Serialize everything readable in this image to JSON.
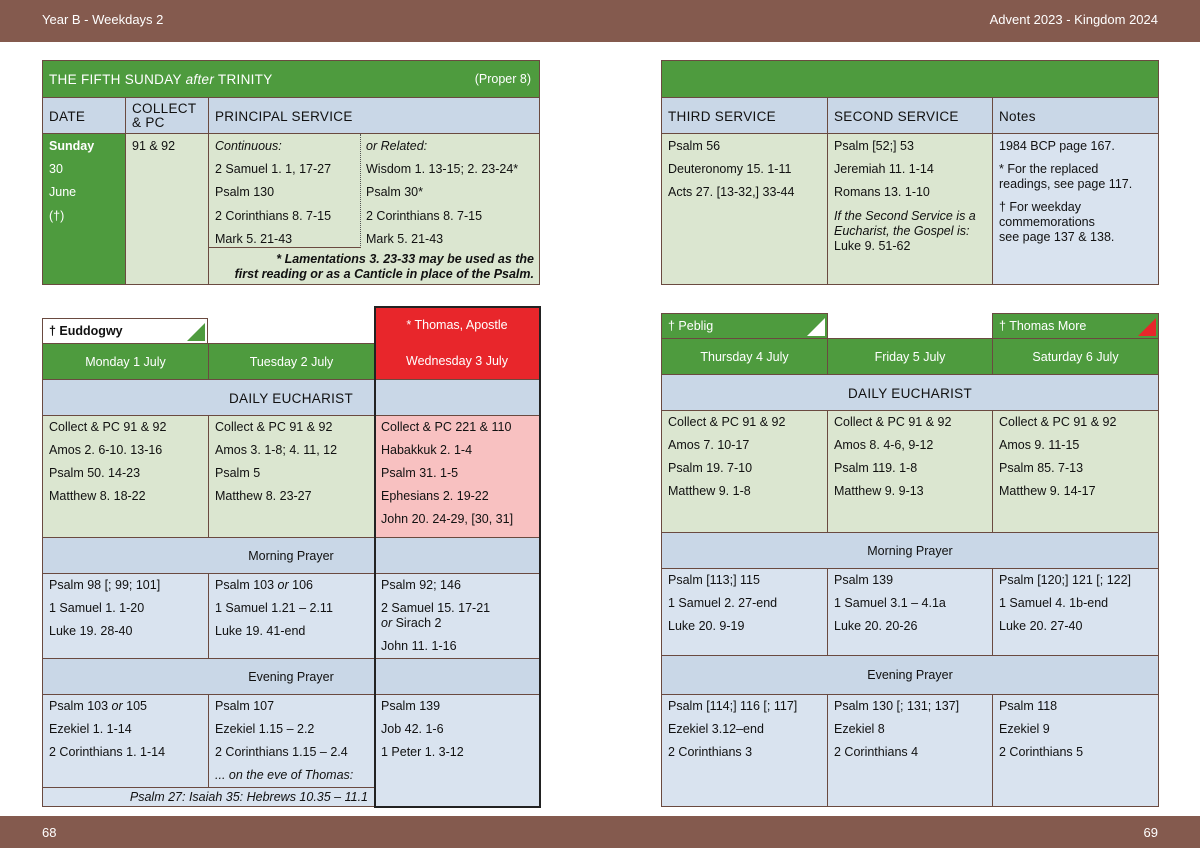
{
  "header": {
    "left": "Year B - Weekdays 2",
    "right": "Advent  2023 - Kingdom 2024"
  },
  "footer": {
    "left": "68",
    "right": "69"
  },
  "sunday": {
    "title_a": "THE FIFTH SUNDAY ",
    "title_b": "after",
    "title_c": " TRINITY",
    "proper": "(Proper 8)",
    "col_date": "DATE",
    "col_collect_1": "COLLECT",
    "col_collect_2": "& PC",
    "col_principal": "PRINCIPAL SERVICE",
    "date": [
      "Sunday",
      "30",
      "June",
      "(†)"
    ],
    "collect": "91 & 92",
    "continuous_label": "Continuous:",
    "continuous": [
      "2 Samuel 1. 1, 17-27",
      "Psalm 130",
      "2 Corinthians 8. 7-15",
      "Mark 5. 21-43"
    ],
    "related_label": "or Related:",
    "related": [
      "Wisdom 1. 13-15;  2. 23-24*",
      "Psalm 30*",
      "2 Corinthians 8. 7-15",
      "Mark 5. 21-43"
    ],
    "footnote_1": "* Lamentations 3. 23-33 may be used as the",
    "footnote_2": "first reading or as a Canticle in place of the Psalm.",
    "col_third": "THIRD SERVICE",
    "col_second": "SECOND SERVICE",
    "col_notes": "Notes",
    "third": [
      "Psalm 56",
      "Deuteronomy 15. 1-11",
      "Acts 27. [13-32,] 33-44"
    ],
    "second": [
      "Psalm [52;] 53",
      "Jeremiah 11. 1-14",
      "Romans 13. 1-10"
    ],
    "second_note_1": "If the Second Service is a",
    "second_note_2": "Eucharist, the Gospel is:",
    "second_gospel": "Luke 9. 51-62",
    "notes": [
      "1984 BCP page 167.",
      "* For the replaced",
      "readings, see page 117.",
      "† For weekday",
      "commemorations",
      "see page 137 & 138."
    ]
  },
  "left_week": {
    "commem_mon": "† Euddogwy",
    "commem_wed": "* Thomas, Apostle",
    "days": [
      "Monday 1 July",
      "Tuesday 2 July",
      "Wednesday 3 July"
    ],
    "daily_eucharist": "DAILY EUCHARIST",
    "eucharist": [
      [
        "Collect & PC 91 & 92",
        "Amos 2. 6-10. 13-16",
        "Psalm 50. 14-23",
        "Matthew 8. 18-22"
      ],
      [
        "Collect & PC 91 & 92",
        "Amos 3. 1-8; 4. 11, 12",
        "Psalm 5",
        "Matthew 8. 23-27"
      ],
      [
        "Collect & PC 221 & 110",
        "Habakkuk 2. 1-4",
        "Psalm 31. 1-5",
        "Ephesians 2. 19-22",
        "John 20. 24-29, [30, 31]"
      ]
    ],
    "morning_prayer": "Morning Prayer",
    "morning": [
      [
        "Psalm 98 [; 99; 101]",
        "1 Samuel 1. 1-20",
        "Luke 19. 28-40"
      ],
      [
        "Psalm 103 ",
        "or",
        " 106",
        "1 Samuel 1.21 – 2.11",
        "Luke 19. 41-end"
      ],
      [
        "Psalm 92; 146",
        "2 Samuel 15. 17-21",
        "or",
        " Sirach 2",
        "John 11. 1-16"
      ]
    ],
    "evening_prayer": "Evening Prayer",
    "evening": [
      [
        "Psalm 103 ",
        "or",
        " 105",
        "Ezekiel 1. 1-14",
        "2 Corinthians 1. 1-14"
      ],
      [
        "Psalm 107",
        "Ezekiel 1.15 – 2.2",
        "2 Corinthians 1.15 – 2.4"
      ],
      [
        "Psalm 139",
        "Job 42. 1-6",
        "1 Peter 1. 3-12"
      ]
    ],
    "eve_label": "... on the eve of Thomas:",
    "eve_readings": "Psalm 27:  Isaiah 35:  Hebrews 10.35 – 11.1"
  },
  "right_week": {
    "commem_thu": "† Peblig",
    "commem_sat": "† Thomas More",
    "days": [
      "Thursday 4 July",
      "Friday 5 July",
      "Saturday 6 July"
    ],
    "daily_eucharist": "DAILY EUCHARIST",
    "eucharist": [
      [
        "Collect & PC 91 & 92",
        "Amos 7. 10-17",
        "Psalm 19. 7-10",
        "Matthew 9. 1-8"
      ],
      [
        "Collect & PC 91 & 92",
        "Amos 8. 4-6, 9-12",
        "Psalm 119. 1-8",
        "Matthew 9. 9-13"
      ],
      [
        "Collect & PC 91 & 92",
        "Amos 9. 11-15",
        "Psalm 85. 7-13",
        "Matthew 9. 14-17"
      ]
    ],
    "morning_prayer": "Morning Prayer",
    "morning": [
      [
        "Psalm [113;] 115",
        "1 Samuel 2. 27-end",
        "Luke 20. 9-19"
      ],
      [
        "Psalm 139",
        "1 Samuel 3.1 – 4.1a",
        "Luke 20. 20-26"
      ],
      [
        "Psalm [120;] 121 [; 122]",
        "1 Samuel 4. 1b-end",
        "Luke 20. 27-40"
      ]
    ],
    "evening_prayer": "Evening Prayer",
    "evening": [
      [
        "Psalm [114;] 116 [; 117]",
        "Ezekiel 3.12–end",
        "2 Corinthians 3"
      ],
      [
        "Psalm 130 [; 131; 137]",
        "Ezekiel 8",
        "2 Corinthians 4"
      ],
      [
        "Psalm 118",
        "Ezekiel 9",
        "2 Corinthians 5"
      ]
    ]
  }
}
